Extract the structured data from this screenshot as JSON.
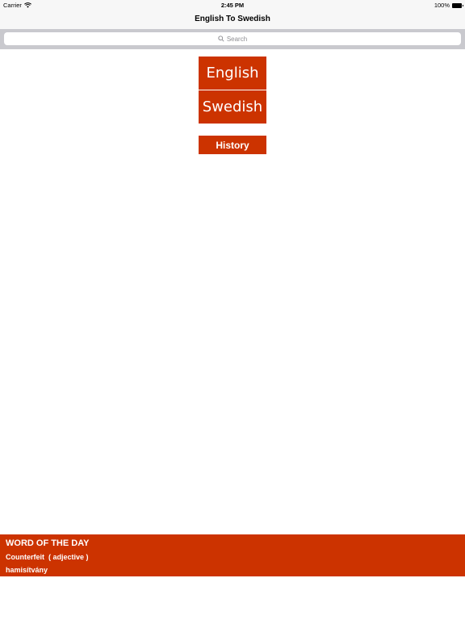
{
  "status_bar": {
    "carrier": "Carrier",
    "time": "2:45 PM",
    "battery": "100%"
  },
  "nav": {
    "title": "English To Swedish"
  },
  "search": {
    "placeholder": "Search"
  },
  "languages": {
    "english_label": "English",
    "swedish_label": "Swedish"
  },
  "history": {
    "label": "History"
  },
  "word_of_the_day": {
    "heading": "WORD OF THE DAY",
    "word": "Counterfeit  ( adjective )",
    "translation": "hamisítvány"
  },
  "colors": {
    "accent": "#cc3300",
    "bar_background": "#f7f7f7",
    "search_background": "#c9c9ce"
  }
}
